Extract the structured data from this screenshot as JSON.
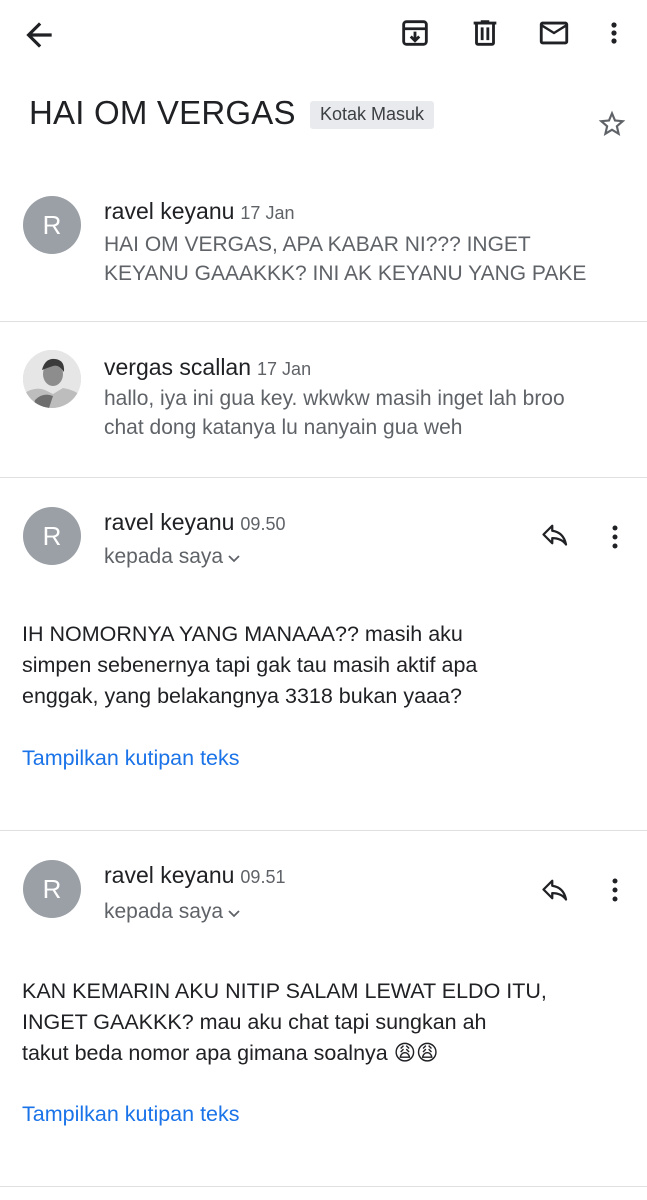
{
  "toolbar": {
    "back_icon": "arrow-back-icon",
    "archive_icon": "archive-icon",
    "delete_icon": "trash-icon",
    "mail_icon": "mail-icon",
    "more_icon": "more-vert-icon"
  },
  "thread": {
    "subject": "HAI OM VERGAS",
    "label": "Kotak Masuk",
    "star_icon": "star-outline-icon"
  },
  "messages": [
    {
      "avatar_letter": "R",
      "sender": "ravel keyanu",
      "time": "17 Jan",
      "snippet_line1": "HAI OM VERGAS, APA KABAR NI??? INGET",
      "snippet_line2": "KEYANU GAAAKKK? INI AK KEYANU YANG PAKE"
    },
    {
      "avatar_type": "photo",
      "sender": "vergas scallan",
      "time": "17 Jan",
      "snippet_line1": "hallo, iya ini gua key. wkwkw masih inget lah broo",
      "snippet_line2": "chat dong katanya lu nanyain gua weh"
    },
    {
      "avatar_letter": "R",
      "sender": "ravel keyanu",
      "time": "09.50",
      "recipient": "kepada saya",
      "body_line1": "IH NOMORNYA YANG MANAAA?? masih aku",
      "body_line2": "simpen sebenernya tapi gak tau masih aktif apa",
      "body_line3": "enggak, yang belakangnya 3318 bukan yaaa?",
      "quote_link": "Tampilkan kutipan teks"
    },
    {
      "avatar_letter": "R",
      "sender": "ravel keyanu",
      "time": "09.51",
      "recipient": "kepada saya",
      "body_line1": "KAN KEMARIN AKU NITIP SALAM LEWAT ELDO ITU,",
      "body_line2": "INGET GAAKKK? mau aku chat tapi sungkan ah",
      "body_line3": "takut beda nomor apa gimana soalnya 😩😩",
      "quote_link": "Tampilkan kutipan teks"
    }
  ],
  "colors": {
    "link": "#1a73e8",
    "avatar_bg": "#9aa0a6",
    "chip_bg": "#e8eaed"
  }
}
